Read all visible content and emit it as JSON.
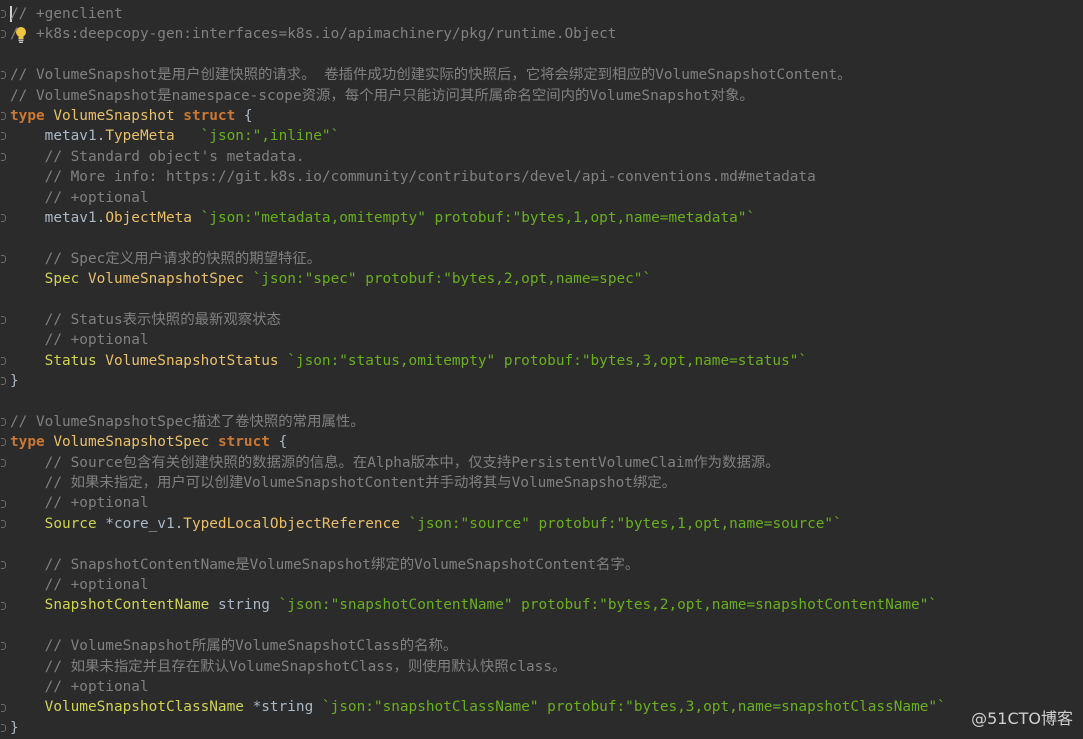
{
  "editor": {
    "lines": [
      [
        {
          "t": "// +genclient",
          "c": "comment"
        }
      ],
      [
        {
          "t": "/  +k8s:deepcopy-gen:interfaces=k8s.io/apimachinery/pkg/runtime.Object",
          "c": "comment"
        }
      ],
      [],
      [
        {
          "t": "// VolumeSnapshot是用户创建快照的请求。 卷插件成功创建实际的快照后，它将会绑定到相应的VolumeSnapshotContent。",
          "c": "comment"
        }
      ],
      [
        {
          "t": "// VolumeSnapshot是namespace-scope资源，每个用户只能访问其所属命名空间内的VolumeSnapshot对象。",
          "c": "comment"
        }
      ],
      [
        {
          "t": "type",
          "c": "keyword"
        },
        {
          "t": " VolumeSnapshot ",
          "c": "type"
        },
        {
          "t": "struct",
          "c": "keyword"
        },
        {
          "t": " {",
          "c": "punct"
        }
      ],
      [
        {
          "t": "    metav1.",
          "c": "ident"
        },
        {
          "t": "TypeMeta",
          "c": "type"
        },
        {
          "t": "   ",
          "c": "punct"
        },
        {
          "t": "`json:\",inline\"`",
          "c": "tag"
        }
      ],
      [
        {
          "t": "    // Standard object's metadata.",
          "c": "comment"
        }
      ],
      [
        {
          "t": "    // More info: https://git.k8s.io/community/contributors/devel/api-conventions.md#metadata",
          "c": "comment"
        }
      ],
      [
        {
          "t": "    // +optional",
          "c": "comment"
        }
      ],
      [
        {
          "t": "    metav1.",
          "c": "ident"
        },
        {
          "t": "ObjectMeta",
          "c": "type"
        },
        {
          "t": " ",
          "c": "punct"
        },
        {
          "t": "`json:\"metadata,omitempty\" protobuf:\"bytes,1,opt,name=metadata\"`",
          "c": "tag"
        }
      ],
      [],
      [
        {
          "t": "    // Spec定义用户请求的快照的期望特征。",
          "c": "comment"
        }
      ],
      [
        {
          "t": "    Spec",
          "c": "field"
        },
        {
          "t": " VolumeSnapshotSpec ",
          "c": "type"
        },
        {
          "t": "`json:\"spec\" protobuf:\"bytes,2,opt,name=spec\"`",
          "c": "tag"
        }
      ],
      [],
      [
        {
          "t": "    // Status表示快照的最新观察状态",
          "c": "comment"
        }
      ],
      [
        {
          "t": "    // +optional",
          "c": "comment"
        }
      ],
      [
        {
          "t": "    Status",
          "c": "field"
        },
        {
          "t": " VolumeSnapshotStatus ",
          "c": "type"
        },
        {
          "t": "`json:\"status,omitempty\" protobuf:\"bytes,3,opt,name=status\"`",
          "c": "tag"
        }
      ],
      [
        {
          "t": "}",
          "c": "punct"
        }
      ],
      [],
      [
        {
          "t": "// VolumeSnapshotSpec描述了卷快照的常用属性。",
          "c": "comment"
        }
      ],
      [
        {
          "t": "type",
          "c": "keyword"
        },
        {
          "t": " VolumeSnapshotSpec ",
          "c": "type"
        },
        {
          "t": "struct",
          "c": "keyword"
        },
        {
          "t": " {",
          "c": "punct"
        }
      ],
      [
        {
          "t": "    // Source包含有关创建快照的数据源的信息。在Alpha版本中，仅支持PersistentVolumeClaim作为数据源。",
          "c": "comment"
        }
      ],
      [
        {
          "t": "    // 如果未指定，用户可以创建VolumeSnapshotContent并手动将其与VolumeSnapshot绑定。",
          "c": "comment"
        }
      ],
      [
        {
          "t": "    // +optional",
          "c": "comment"
        }
      ],
      [
        {
          "t": "    Source",
          "c": "field"
        },
        {
          "t": " *core_v1.",
          "c": "ident"
        },
        {
          "t": "TypedLocalObjectReference",
          "c": "type"
        },
        {
          "t": " ",
          "c": "punct"
        },
        {
          "t": "`json:\"source\" protobuf:\"bytes,1,opt,name=source\"`",
          "c": "tag"
        }
      ],
      [],
      [
        {
          "t": "    // SnapshotContentName是VolumeSnapshot绑定的VolumeSnapshotContent名字。",
          "c": "comment"
        }
      ],
      [
        {
          "t": "    // +optional",
          "c": "comment"
        }
      ],
      [
        {
          "t": "    SnapshotContentName",
          "c": "field"
        },
        {
          "t": " string ",
          "c": "ident"
        },
        {
          "t": "`json:\"snapshotContentName\" protobuf:\"bytes,2,opt,name=snapshotContentName\"`",
          "c": "tag"
        }
      ],
      [],
      [
        {
          "t": "    // VolumeSnapshot所属的VolumeSnapshotClass的名称。",
          "c": "comment"
        }
      ],
      [
        {
          "t": "    // 如果未指定并且存在默认VolumeSnapshotClass，则使用默认快照class。",
          "c": "comment"
        }
      ],
      [
        {
          "t": "    // +optional",
          "c": "comment"
        }
      ],
      [
        {
          "t": "    VolumeSnapshotClassName",
          "c": "field"
        },
        {
          "t": " *string ",
          "c": "ident"
        },
        {
          "t": "`json:\"snapshotClassName\" protobuf:\"bytes,3,opt,name=snapshotClassName\"`",
          "c": "tag"
        }
      ],
      [
        {
          "t": "}",
          "c": "punct"
        }
      ]
    ],
    "fold_lines": [
      0,
      1,
      3,
      5,
      6,
      7,
      10,
      12,
      15,
      17,
      18,
      20,
      21,
      22,
      24,
      25,
      27,
      29,
      31,
      34,
      35
    ]
  },
  "watermark": "@51CTO博客",
  "colors": {
    "background": "#2b2b2b",
    "comment": "#808080",
    "keyword": "#cc7832",
    "type": "#e8bf6a",
    "field": "#cfd34f",
    "tag": "#6aaf1d"
  },
  "icons": {
    "caret": "text-caret",
    "bulb": "lightbulb-icon"
  }
}
